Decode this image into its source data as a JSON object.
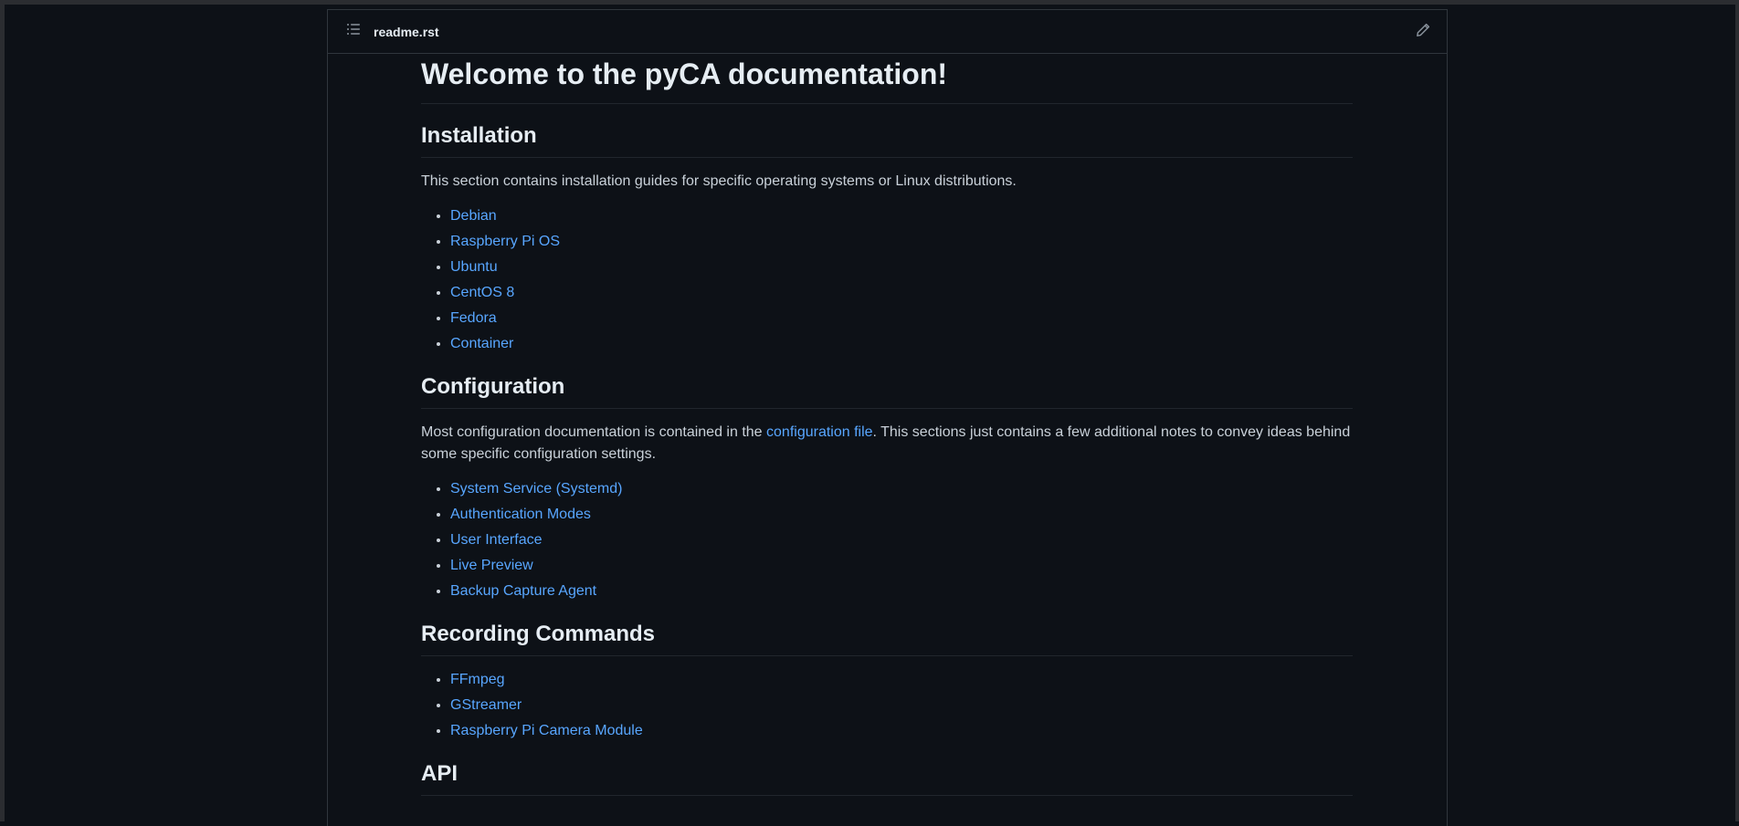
{
  "readme_header": {
    "file_name": "readme.rst",
    "toc_icon": "list-unordered-icon",
    "edit_icon": "pencil-icon"
  },
  "article": {
    "title": "Welcome to the pyCA documentation!",
    "installation": {
      "heading": "Installation",
      "intro": "This section contains installation guides for specific operating systems or Linux distributions.",
      "items": [
        "Debian",
        "Raspberry Pi OS",
        "Ubuntu",
        "CentOS 8",
        "Fedora",
        "Container"
      ]
    },
    "configuration": {
      "heading": "Configuration",
      "intro_before": "Most configuration documentation is contained in the ",
      "intro_link": "configuration file",
      "intro_after": ". This sections just contains a few additional notes to convey ideas behind some specific configuration settings.",
      "items": [
        "System Service (Systemd)",
        "Authentication Modes",
        "User Interface",
        "Live Preview",
        "Backup Capture Agent"
      ]
    },
    "recording": {
      "heading": "Recording Commands",
      "items": [
        "FFmpeg",
        "GStreamer",
        "Raspberry Pi Camera Module"
      ]
    },
    "api": {
      "heading": "API"
    }
  },
  "colors": {
    "background": "#0d1117",
    "border": "#30363d",
    "text": "#c9d1d9",
    "heading": "#e6edf3",
    "link": "#58a6ff"
  }
}
